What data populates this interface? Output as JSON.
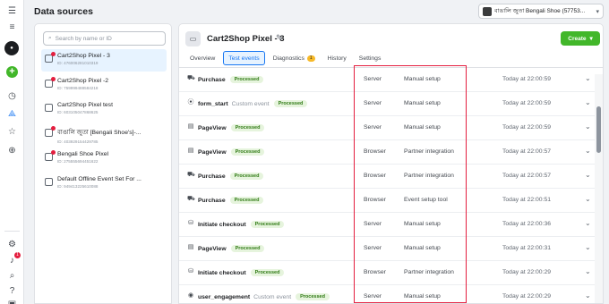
{
  "app": {
    "title": "Data sources"
  },
  "account": {
    "name": "বাঙালি জুতা Bengali Shoe (57753...",
    "chevron": "chevron-down-icon"
  },
  "rail": {
    "items": [
      {
        "icon": "hamburger-icon"
      },
      {
        "icon": "menu-icon"
      },
      {
        "icon": "business-logo"
      },
      {
        "icon": "plus-icon"
      },
      {
        "icon": "dashboard-icon"
      },
      {
        "icon": "events-manager-icon",
        "active": true
      },
      {
        "icon": "star-icon"
      },
      {
        "icon": "brain-icon"
      },
      {
        "icon": "settings-icon"
      },
      {
        "icon": "notifications-icon",
        "badge": "1"
      },
      {
        "icon": "search-icon"
      },
      {
        "icon": "help-icon"
      },
      {
        "icon": "report-icon"
      }
    ]
  },
  "search": {
    "placeholder": "Search by name or ID"
  },
  "sources": [
    {
      "name": "Cart2Shop Pixel - 3",
      "id": "ID: 476006281010319",
      "selected": true,
      "warn": true
    },
    {
      "name": "Cart2Shop Pixel -2",
      "id": "ID: 759999488584218",
      "warn": true
    },
    {
      "name": "Cart2Shop Pixel test",
      "id": "ID: 603105047868625",
      "warn": false
    },
    {
      "name": "বাঙালি জুতা [Bengali Shoe's]-...",
      "id": "ID: 403929154429785",
      "warn": true
    },
    {
      "name": "Bengali Shoe Pixel",
      "id": "ID: 275555694451622",
      "warn": true
    },
    {
      "name": "Default Offline Event Set For ...",
      "id": "ID: 949413225610088",
      "warn": false
    }
  ],
  "pixel": {
    "name": "Cart2Shop Pixel - 3",
    "edit_icon": "pencil-icon"
  },
  "create": {
    "label": "Create"
  },
  "tabs": [
    {
      "label": "Overview"
    },
    {
      "label": "Test events",
      "active": true
    },
    {
      "label": "Diagnostics",
      "badge": "1"
    },
    {
      "label": "History"
    },
    {
      "label": "Settings"
    }
  ],
  "events": [
    {
      "icon": "cart-icon",
      "name": "Purchase",
      "custom": "",
      "status": "Processed",
      "channel": "Server",
      "setup": "Manual setup",
      "time": "Today at 22:00:59"
    },
    {
      "icon": "form-icon",
      "name": "form_start",
      "custom": "Custom event",
      "status": "Processed",
      "channel": "Server",
      "setup": "Manual setup",
      "time": "Today at 22:00:59"
    },
    {
      "icon": "page-icon",
      "name": "PageView",
      "custom": "",
      "status": "Processed",
      "channel": "Server",
      "setup": "Manual setup",
      "time": "Today at 22:00:59"
    },
    {
      "icon": "page-icon",
      "name": "PageView",
      "custom": "",
      "status": "Processed",
      "channel": "Browser",
      "setup": "Partner integration",
      "time": "Today at 22:00:57"
    },
    {
      "icon": "cart-icon",
      "name": "Purchase",
      "custom": "",
      "status": "Processed",
      "channel": "Browser",
      "setup": "Partner integration",
      "time": "Today at 22:00:57"
    },
    {
      "icon": "cart-icon",
      "name": "Purchase",
      "custom": "",
      "status": "Processed",
      "channel": "Browser",
      "setup": "Event setup tool",
      "time": "Today at 22:00:51"
    },
    {
      "icon": "checkout-icon",
      "name": "Initiate checkout",
      "custom": "",
      "status": "Processed",
      "channel": "Server",
      "setup": "Manual setup",
      "time": "Today at 22:00:36"
    },
    {
      "icon": "page-icon",
      "name": "PageView",
      "custom": "",
      "status": "Processed",
      "channel": "Server",
      "setup": "Manual setup",
      "time": "Today at 22:00:31"
    },
    {
      "icon": "checkout-icon",
      "name": "Initiate checkout",
      "custom": "",
      "status": "Processed",
      "channel": "Browser",
      "setup": "Partner integration",
      "time": "Today at 22:00:29"
    },
    {
      "icon": "engagement-icon",
      "name": "user_engagement",
      "custom": "Custom event",
      "status": "Processed",
      "channel": "Server",
      "setup": "Manual setup",
      "time": "Today at 22:00:29"
    }
  ]
}
